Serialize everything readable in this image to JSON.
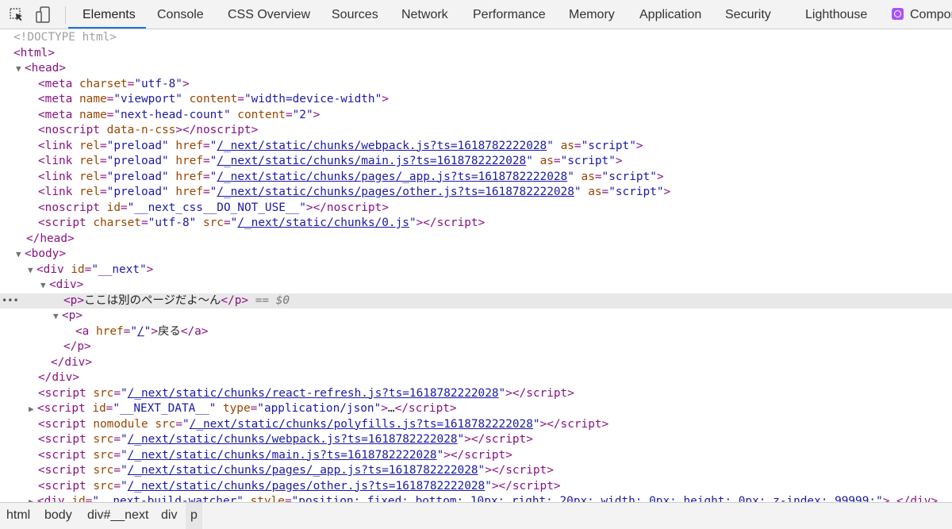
{
  "toolbar": {
    "tabs": [
      {
        "label": "Elements"
      },
      {
        "label": "Console"
      },
      {
        "label": "CSS Overview"
      },
      {
        "label": "Sources"
      },
      {
        "label": "Network"
      },
      {
        "label": "Performance"
      },
      {
        "label": "Memory"
      },
      {
        "label": "Application"
      },
      {
        "label": "Security"
      },
      {
        "label": "Lighthouse"
      },
      {
        "label": "Compor"
      }
    ],
    "active_tab": "Elements",
    "accent_color": "#1a73e8"
  },
  "tree": {
    "doctype": "<!DOCTYPE html>",
    "ts": "1618782222028",
    "selected_text": "ここは別のページだよ〜ん",
    "selected_marker": "== $0",
    "link_text": "戻る",
    "next_data_ellipsis": "…",
    "watcher_style": "position: fixed; bottom: 10px; right: 20px; width: 0px; height: 0px; z-index: 99999;"
  },
  "breadcrumb": {
    "items": [
      {
        "label": "html"
      },
      {
        "label": "body"
      },
      {
        "label": "div#__next"
      },
      {
        "label": "div"
      },
      {
        "label": "p"
      }
    ]
  },
  "colors": {
    "tag": "#881280",
    "attr_name": "#994500",
    "attr_value": "#1a1aa6",
    "selected_row": "#e8e8e8"
  }
}
